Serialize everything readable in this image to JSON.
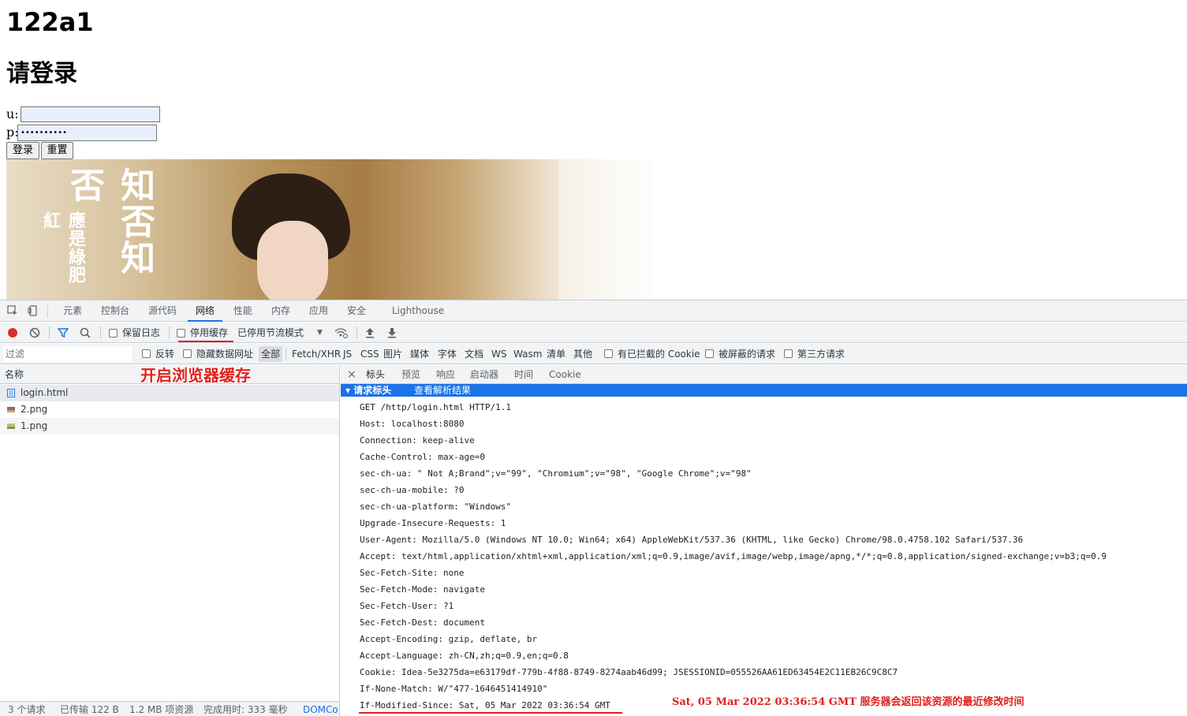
{
  "page": {
    "heading": "122a1",
    "subheading": "请登录",
    "user_label": "u:",
    "pass_label": "p:",
    "pass_value": "••••••••••",
    "login_button": "登录",
    "reset_button": "重置",
    "banner_title": "知否知否",
    "banner_subtitle": "應是綠肥紅"
  },
  "devtools": {
    "tabs": [
      "元素",
      "控制台",
      "源代码",
      "网络",
      "性能",
      "内存",
      "应用",
      "安全",
      "Lighthouse"
    ],
    "active_tab": "网络",
    "toolbar": {
      "preserve_log": "保留日志",
      "disable_cache": "停用缓存",
      "throttling": "已停用节流模式"
    },
    "filter": {
      "placeholder": "过滤",
      "invert": "反转",
      "hide_data_urls": "隐藏数据网址",
      "types": [
        "全部",
        "Fetch/XHR",
        "JS",
        "CSS",
        "图片",
        "媒体",
        "字体",
        "文档",
        "WS",
        "Wasm",
        "清单",
        "其他"
      ],
      "blocked_cookies": "有已拦截的 Cookie",
      "blocked_requests": "被屏蔽的请求",
      "third_party": "第三方请求"
    },
    "list": {
      "header": "名称",
      "rows": [
        "login.html",
        "2.png",
        "1.png"
      ]
    },
    "status": {
      "requests": "3 个请求",
      "transferred": "已传输 122 B",
      "resources": "1.2 MB 项资源",
      "finish": "完成用时: 333 毫秒",
      "domcontent": "DOMCo"
    },
    "detail": {
      "close": "×",
      "tabs": [
        "标头",
        "预览",
        "响应",
        "启动器",
        "时间",
        "Cookie"
      ],
      "section_title": "▾ 请求标头",
      "view_parsed": "查看解析结果",
      "headers": [
        "GET /http/login.html HTTP/1.1",
        "Host: localhost:8080",
        "Connection: keep-alive",
        "Cache-Control: max-age=0",
        "sec-ch-ua: \" Not A;Brand\";v=\"99\", \"Chromium\";v=\"98\", \"Google Chrome\";v=\"98\"",
        "sec-ch-ua-mobile: ?0",
        "sec-ch-ua-platform: \"Windows\"",
        "Upgrade-Insecure-Requests: 1",
        "User-Agent: Mozilla/5.0 (Windows NT 10.0; Win64; x64) AppleWebKit/537.36 (KHTML, like Gecko) Chrome/98.0.4758.102 Safari/537.36",
        "Accept: text/html,application/xhtml+xml,application/xml;q=0.9,image/avif,image/webp,image/apng,*/*;q=0.8,application/signed-exchange;v=b3;q=0.9",
        "Sec-Fetch-Site: none",
        "Sec-Fetch-Mode: navigate",
        "Sec-Fetch-User: ?1",
        "Sec-Fetch-Dest: document",
        "Accept-Encoding: gzip, deflate, br",
        "Accept-Language: zh-CN,zh;q=0.9,en;q=0.8",
        "Cookie: Idea-5e3275da=e63179df-779b-4f88-8749-8274aab46d99; JSESSIONID=055526AA61ED63454E2C11EB26C9C8C7",
        "If-None-Match: W/\"477-1646451414910\"",
        "If-Modified-Since: Sat, 05 Mar 2022 03:36:54 GMT"
      ]
    }
  },
  "annotations": {
    "cache_note": "开启浏览器缓存",
    "modified_note": "Sat, 05 Mar 2022 03:36:54 GMT 服务器会返回该资源的最近修改时间"
  },
  "colors": {
    "accent": "#1a73e8",
    "annotation": "#e0201c",
    "record": "#d93025"
  }
}
